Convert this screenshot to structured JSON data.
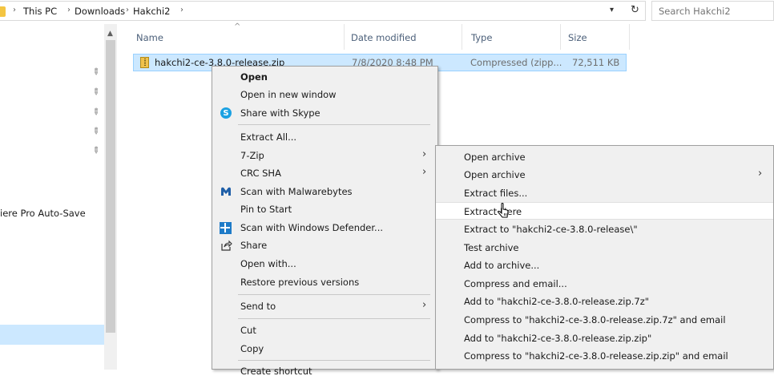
{
  "breadcrumb": {
    "items": [
      "This PC",
      "Downloads",
      "Hakchi2"
    ]
  },
  "search": {
    "placeholder": "Search Hakchi2"
  },
  "nav": {
    "autosave_label": "iere Pro Auto-Save"
  },
  "columns": {
    "name": "Name",
    "date": "Date modified",
    "type": "Type",
    "size": "Size"
  },
  "file": {
    "name": "hakchi2-ce-3.8.0-release.zip",
    "date": "7/8/2020 8:48 PM",
    "type": "Compressed (zipp...",
    "size": "72,511 KB"
  },
  "context_menu": {
    "items": [
      {
        "label": "Open"
      },
      {
        "label": "Open in new window"
      },
      {
        "label": "Share with Skype"
      },
      {
        "label": "Extract All..."
      },
      {
        "label": "7-Zip"
      },
      {
        "label": "CRC SHA"
      },
      {
        "label": "Scan with Malwarebytes"
      },
      {
        "label": "Pin to Start"
      },
      {
        "label": "Scan with Windows Defender..."
      },
      {
        "label": "Share"
      },
      {
        "label": "Open with..."
      },
      {
        "label": "Restore previous versions"
      },
      {
        "label": "Send to"
      },
      {
        "label": "Cut"
      },
      {
        "label": "Copy"
      },
      {
        "label": "Create shortcut"
      }
    ]
  },
  "submenu_7zip": {
    "items": [
      {
        "label": "Open archive"
      },
      {
        "label": "Open archive"
      },
      {
        "label": "Extract files..."
      },
      {
        "label": "Extract Here"
      },
      {
        "label": "Extract to \"hakchi2-ce-3.8.0-release\\\""
      },
      {
        "label": "Test archive"
      },
      {
        "label": "Add to archive..."
      },
      {
        "label": "Compress and email..."
      },
      {
        "label": "Add to \"hakchi2-ce-3.8.0-release.zip.7z\""
      },
      {
        "label": "Compress to \"hakchi2-ce-3.8.0-release.zip.7z\" and email"
      },
      {
        "label": "Add to \"hakchi2-ce-3.8.0-release.zip.zip\""
      },
      {
        "label": "Compress to \"hakchi2-ce-3.8.0-release.zip.zip\" and email"
      }
    ],
    "highlighted": "Extract Here"
  },
  "colors": {
    "selection": "#cce8ff",
    "selection_border": "#99d1ff",
    "menu_bg": "#f0f0f0",
    "menu_highlight": "#ffffff"
  }
}
